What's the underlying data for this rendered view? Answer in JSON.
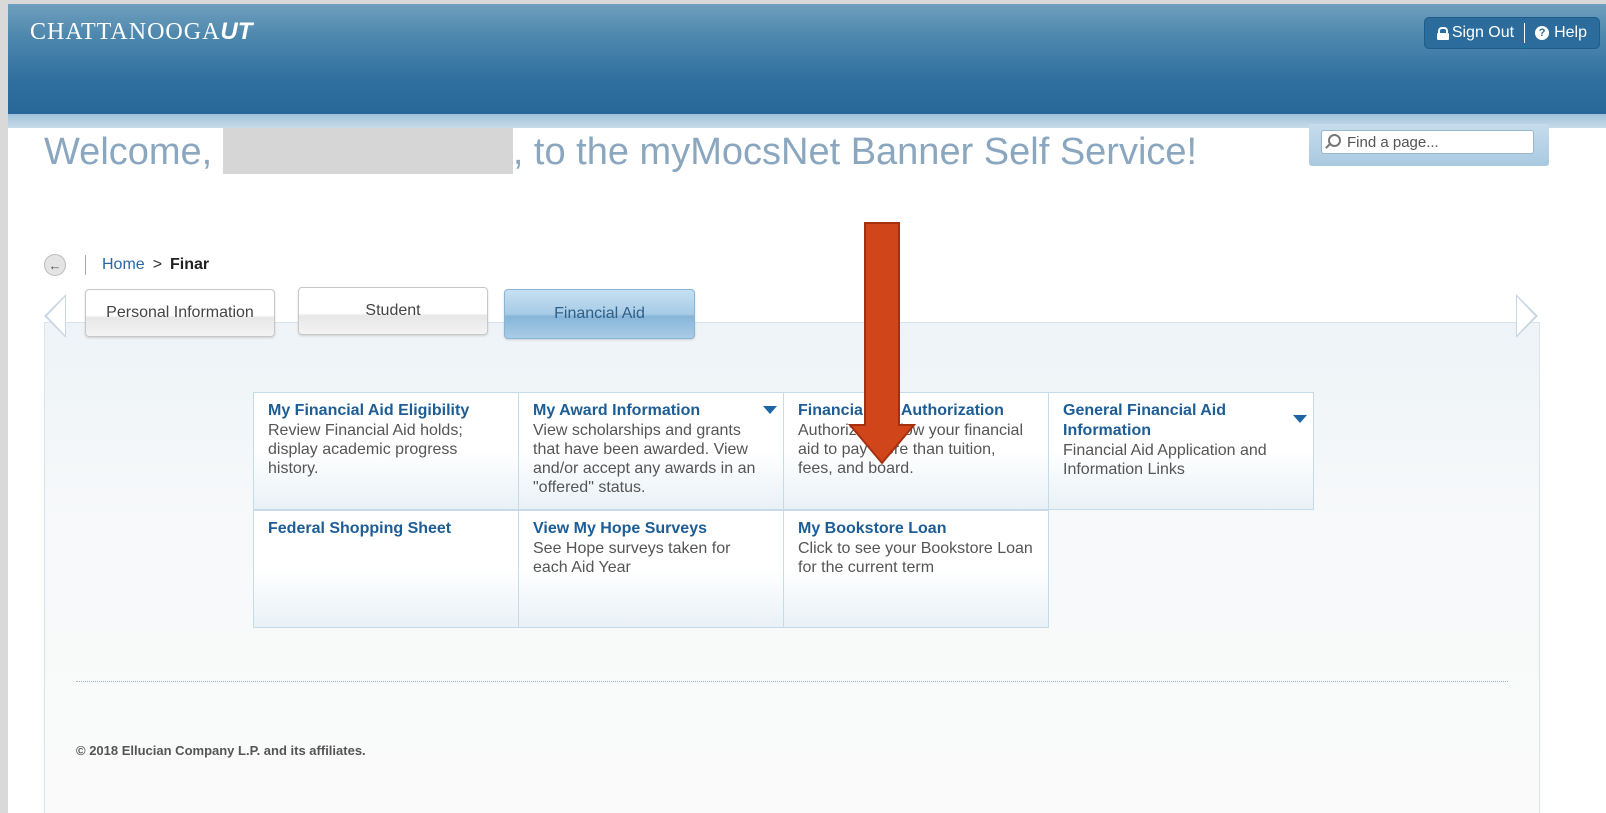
{
  "header": {
    "logo_text": "CHATTANOOGA",
    "logo_ut": "UT",
    "sign_out": "Sign Out",
    "help": "Help"
  },
  "welcome": {
    "prefix": "Welcome,",
    "suffix": ", to the myMocsNet Banner Self Service!"
  },
  "search": {
    "placeholder": "Find a page..."
  },
  "breadcrumb": {
    "home": "Home",
    "arrow": ">",
    "current": "Finar"
  },
  "tabs": [
    {
      "label": "Personal Information"
    },
    {
      "label": "Student"
    },
    {
      "label": "Financial Aid"
    }
  ],
  "cards": [
    {
      "title": "My Financial Aid Eligibility",
      "desc": "Review Financial Aid holds; display academic progress history."
    },
    {
      "title": "My Award Information",
      "desc": "View scholarships and grants that have been awarded. View and/or accept any awards in an \"offered\" status."
    },
    {
      "title": "Financial Aid Authorization",
      "desc": "Authorize to allow your financial aid to pay more than tuition, fees, and board."
    },
    {
      "title": "General Financial Aid Information",
      "desc": "Financial Aid Application and Information Links"
    },
    {
      "title": "Federal Shopping Sheet",
      "desc": ""
    },
    {
      "title": "View My Hope Surveys",
      "desc": "See Hope surveys taken for each Aid Year"
    },
    {
      "title": "My Bookstore Loan",
      "desc": "Click to see your Bookstore Loan for the current term"
    }
  ],
  "footer": {
    "copyright": "© 2018 Ellucian Company L.P. and its affiliates."
  },
  "colors": {
    "banner": "#2f6f9f",
    "link": "#1d5d95",
    "annotation_arrow": "#d0461a"
  }
}
